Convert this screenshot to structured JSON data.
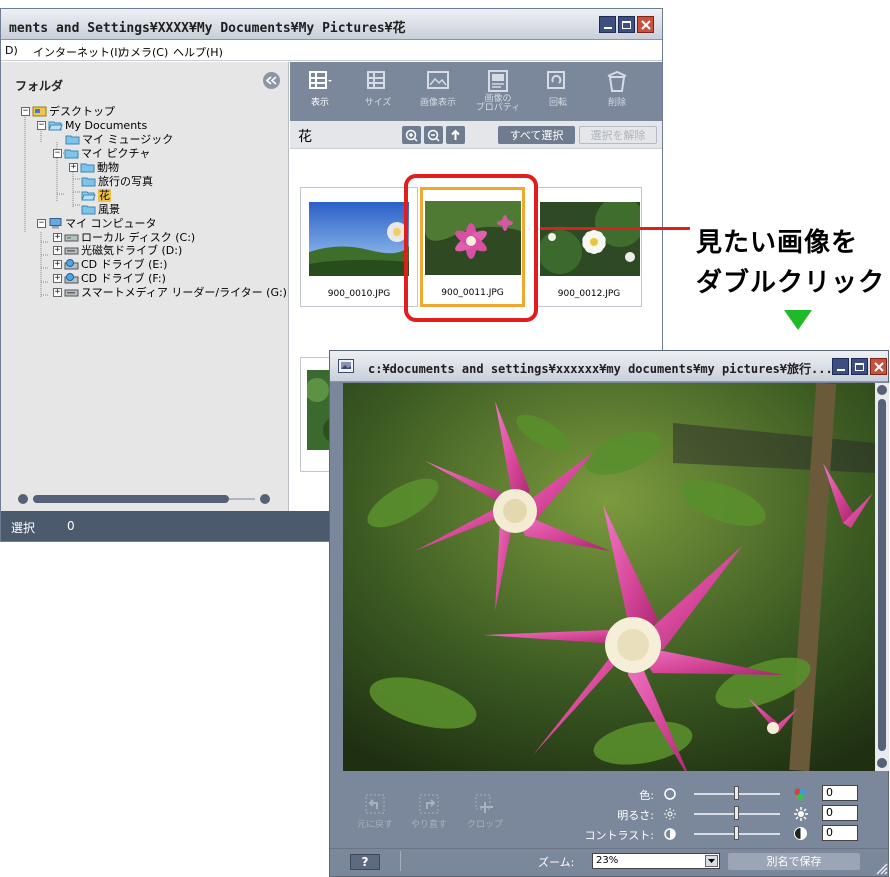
{
  "main_window": {
    "title": "ments and Settings¥XXXX¥My Documents¥My Pictures¥花",
    "menu": [
      "D)",
      "インターネット(I)",
      "カメラ(C)",
      "ヘルプ(H)"
    ],
    "folder_header": "フォルダ",
    "tree": [
      {
        "label": "デスクトップ",
        "expander": "minus",
        "icon": "desktop-icon"
      },
      {
        "label": "My Documents",
        "expander": "minus",
        "icon": "folder-open-icon"
      },
      {
        "label": "マイ ミュージック",
        "expander": "none",
        "icon": "folder-icon"
      },
      {
        "label": "マイ ピクチャ",
        "expander": "minus",
        "icon": "folder-icon"
      },
      {
        "label": "動物",
        "expander": "plus",
        "icon": "folder-icon"
      },
      {
        "label": "旅行の写真",
        "expander": "none",
        "icon": "folder-icon"
      },
      {
        "label": "花",
        "expander": "none",
        "icon": "folder-open-icon",
        "selected": true
      },
      {
        "label": "風景",
        "expander": "none",
        "icon": "folder-icon"
      },
      {
        "label": "マイ コンピュータ",
        "expander": "minus",
        "icon": "computer-icon"
      },
      {
        "label": "ローカル ディスク (C:)",
        "expander": "plus",
        "icon": "drive-icon"
      },
      {
        "label": "光磁気ドライブ (D:)",
        "expander": "plus",
        "icon": "drive-icon"
      },
      {
        "label": "CD ドライブ (E:)",
        "expander": "plus",
        "icon": "cd-icon"
      },
      {
        "label": "CD ドライブ (F:)",
        "expander": "plus",
        "icon": "cd-icon"
      },
      {
        "label": "スマートメディア リーダー/ライター (G:)",
        "expander": "plus",
        "icon": "drive-icon"
      }
    ],
    "toolbar": [
      {
        "label": "表示",
        "icon": "view-icon",
        "enabled": true
      },
      {
        "label": "サイズ",
        "icon": "size-icon",
        "enabled": false
      },
      {
        "label": "画像表示",
        "icon": "image-view-icon",
        "enabled": false
      },
      {
        "label": "画像の\nプロパティ",
        "icon": "properties-icon",
        "enabled": false
      },
      {
        "label": "回転",
        "icon": "rotate-icon",
        "enabled": false
      },
      {
        "label": "削除",
        "icon": "delete-icon",
        "enabled": false
      }
    ],
    "folder_title": "花",
    "select_all": "すべて選択",
    "deselect": "選択を解除",
    "thumbnails": [
      "900_0010.JPG",
      "900_0011.JPG",
      "900_0012.JPG"
    ],
    "status_label": "選択",
    "status_count": "0"
  },
  "callout": {
    "line1": "見たい画像を",
    "line2": "ダブルクリック",
    "arrow_color": "#1eba28",
    "highlight_color": "#e01e1e"
  },
  "viewer": {
    "title": "c:¥documents and settings¥xxxxxx¥my documents¥my pictures¥旅行...",
    "buttons": [
      "元に戻す",
      "やり直す",
      "クロップ"
    ],
    "adjust": [
      {
        "label": "色:",
        "value": "0",
        "level": 0.5
      },
      {
        "label": "明るさ:",
        "value": "0",
        "level": 0.5
      },
      {
        "label": "コントラスト:",
        "value": "0",
        "level": 0.5
      }
    ],
    "zoom_label": "ズーム:",
    "zoom_value": "23%",
    "save_as": "別名で保存",
    "help": "?"
  },
  "colors": {
    "toolbar_gray": "#7b879a",
    "status_bar": "#4c5a6e",
    "selection_orange": "#f0a830"
  }
}
